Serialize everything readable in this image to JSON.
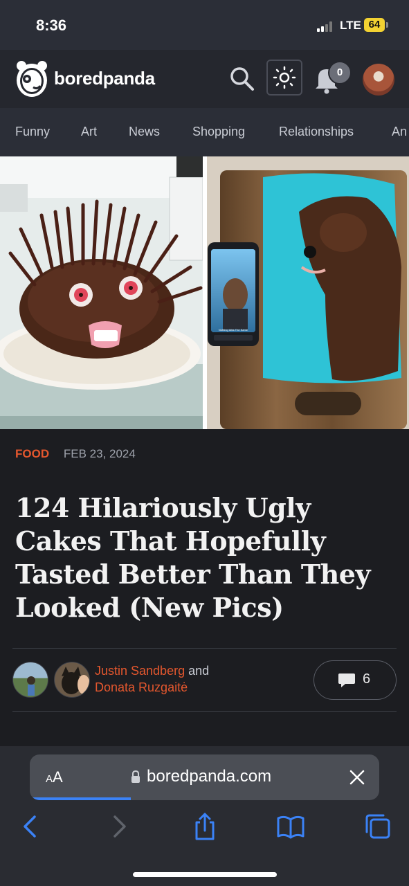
{
  "status_bar": {
    "time": "8:36",
    "network": "LTE",
    "battery": "64"
  },
  "header": {
    "logo_text": "boredpanda",
    "notification_count": "0"
  },
  "nav": {
    "items": [
      "Funny",
      "Art",
      "News",
      "Shopping",
      "Relationships",
      "An"
    ]
  },
  "hero": {
    "left_image": "hedgehog-chocolate-cake-photo",
    "right_image": "drake-portrait-cake-photo",
    "phone_caption_lines": [
      "Nothing Was The Same",
      "DRAKE"
    ]
  },
  "article": {
    "category": "FOOD",
    "date": "FEB 23, 2024",
    "title": "124 Hilariously Ugly Cakes That Hopefully Tasted Better Than They Looked (New Pics)",
    "authors": {
      "first": "Justin Sandberg",
      "conjunction": "and",
      "second": "Donata Ruzgaitė"
    },
    "comment_count": "6"
  },
  "browser": {
    "aa_small": "A",
    "aa_big": "A",
    "url": "boredpanda.com",
    "load_progress": 0.29
  },
  "colors": {
    "accent": "#e4572e",
    "header_bg": "#25272e",
    "nav_bg": "#2b2e37",
    "page_bg": "#1c1d21",
    "link_blue": "#3b82f6"
  },
  "icons": {
    "search": "search-icon",
    "theme": "sun-icon",
    "notifications": "bell-icon",
    "comments": "comment-bubble-icon",
    "lock": "lock-icon",
    "close": "close-icon",
    "back": "chevron-left-icon",
    "forward": "chevron-right-icon",
    "share": "share-icon",
    "bookmarks": "book-icon",
    "tabs": "tabs-icon"
  }
}
